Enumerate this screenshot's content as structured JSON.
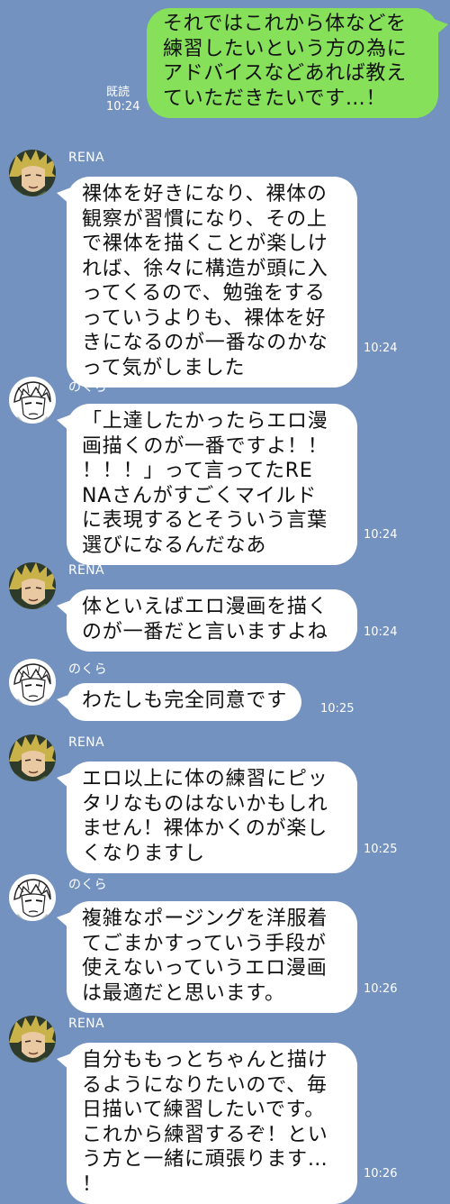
{
  "colors": {
    "background": "#7392c0",
    "sent_bubble": "#86e05a",
    "received_bubble": "#ffffff",
    "meta_text": "#ffffff"
  },
  "messages": [
    {
      "type": "sent",
      "text": "それではこれから体などを\n練習したいという方の為に\nアドバイスなどあれば教え\nていただきたいです…！",
      "read": "既読",
      "time": "10:24"
    },
    {
      "type": "received",
      "sender": "RENA",
      "avatar": "rena-avatar",
      "text": "裸体を好きになり、裸体の\n観察が習慣になり、その上\nで裸体を描くことが楽しけ\nれば、徐々に構造が頭に入\nってくるので、勉強をする\nっていうよりも、裸体を好\nきになるのが一番なのかな\nって気がしました",
      "time": "10:24"
    },
    {
      "type": "received",
      "sender": "のくら",
      "avatar": "nokura-avatar",
      "text": "「上達したかったらエロ漫\n画描くのが一番ですよ！！\n！！！」って言ってたRE\nNAさんがすごくマイルド\nに表現するとそういう言葉\n選びになるんだなあ",
      "time": "10:24"
    },
    {
      "type": "received",
      "sender": "RENA",
      "avatar": "rena-avatar",
      "text": "体といえばエロ漫画を描く\nのが一番だと言いますよね",
      "time": "10:24"
    },
    {
      "type": "received",
      "sender": "のくら",
      "avatar": "nokura-avatar",
      "text": "わたしも完全同意です",
      "time": "10:25"
    },
    {
      "type": "received",
      "sender": "RENA",
      "avatar": "rena-avatar",
      "text": "エロ以上に体の練習にピッ\nタリなものはないかもしれ\nません！裸体かくのが楽し\nくなりますし",
      "time": "10:25"
    },
    {
      "type": "received",
      "sender": "のくら",
      "avatar": "nokura-avatar",
      "text": "複雑なポージングを洋服着\nてごまかすっていう手段が\n使えないっていうエロ漫画\nは最適だと思います。",
      "time": "10:26"
    },
    {
      "type": "received",
      "sender": "RENA",
      "avatar": "rena-avatar",
      "text": "自分ももっとちゃんと描け\nるようになりたいので、毎\n日描いて練習したいです。\nこれから練習するぞ！とい\nう方と一緒に頑張ります…\n！",
      "time": "10:26"
    }
  ]
}
